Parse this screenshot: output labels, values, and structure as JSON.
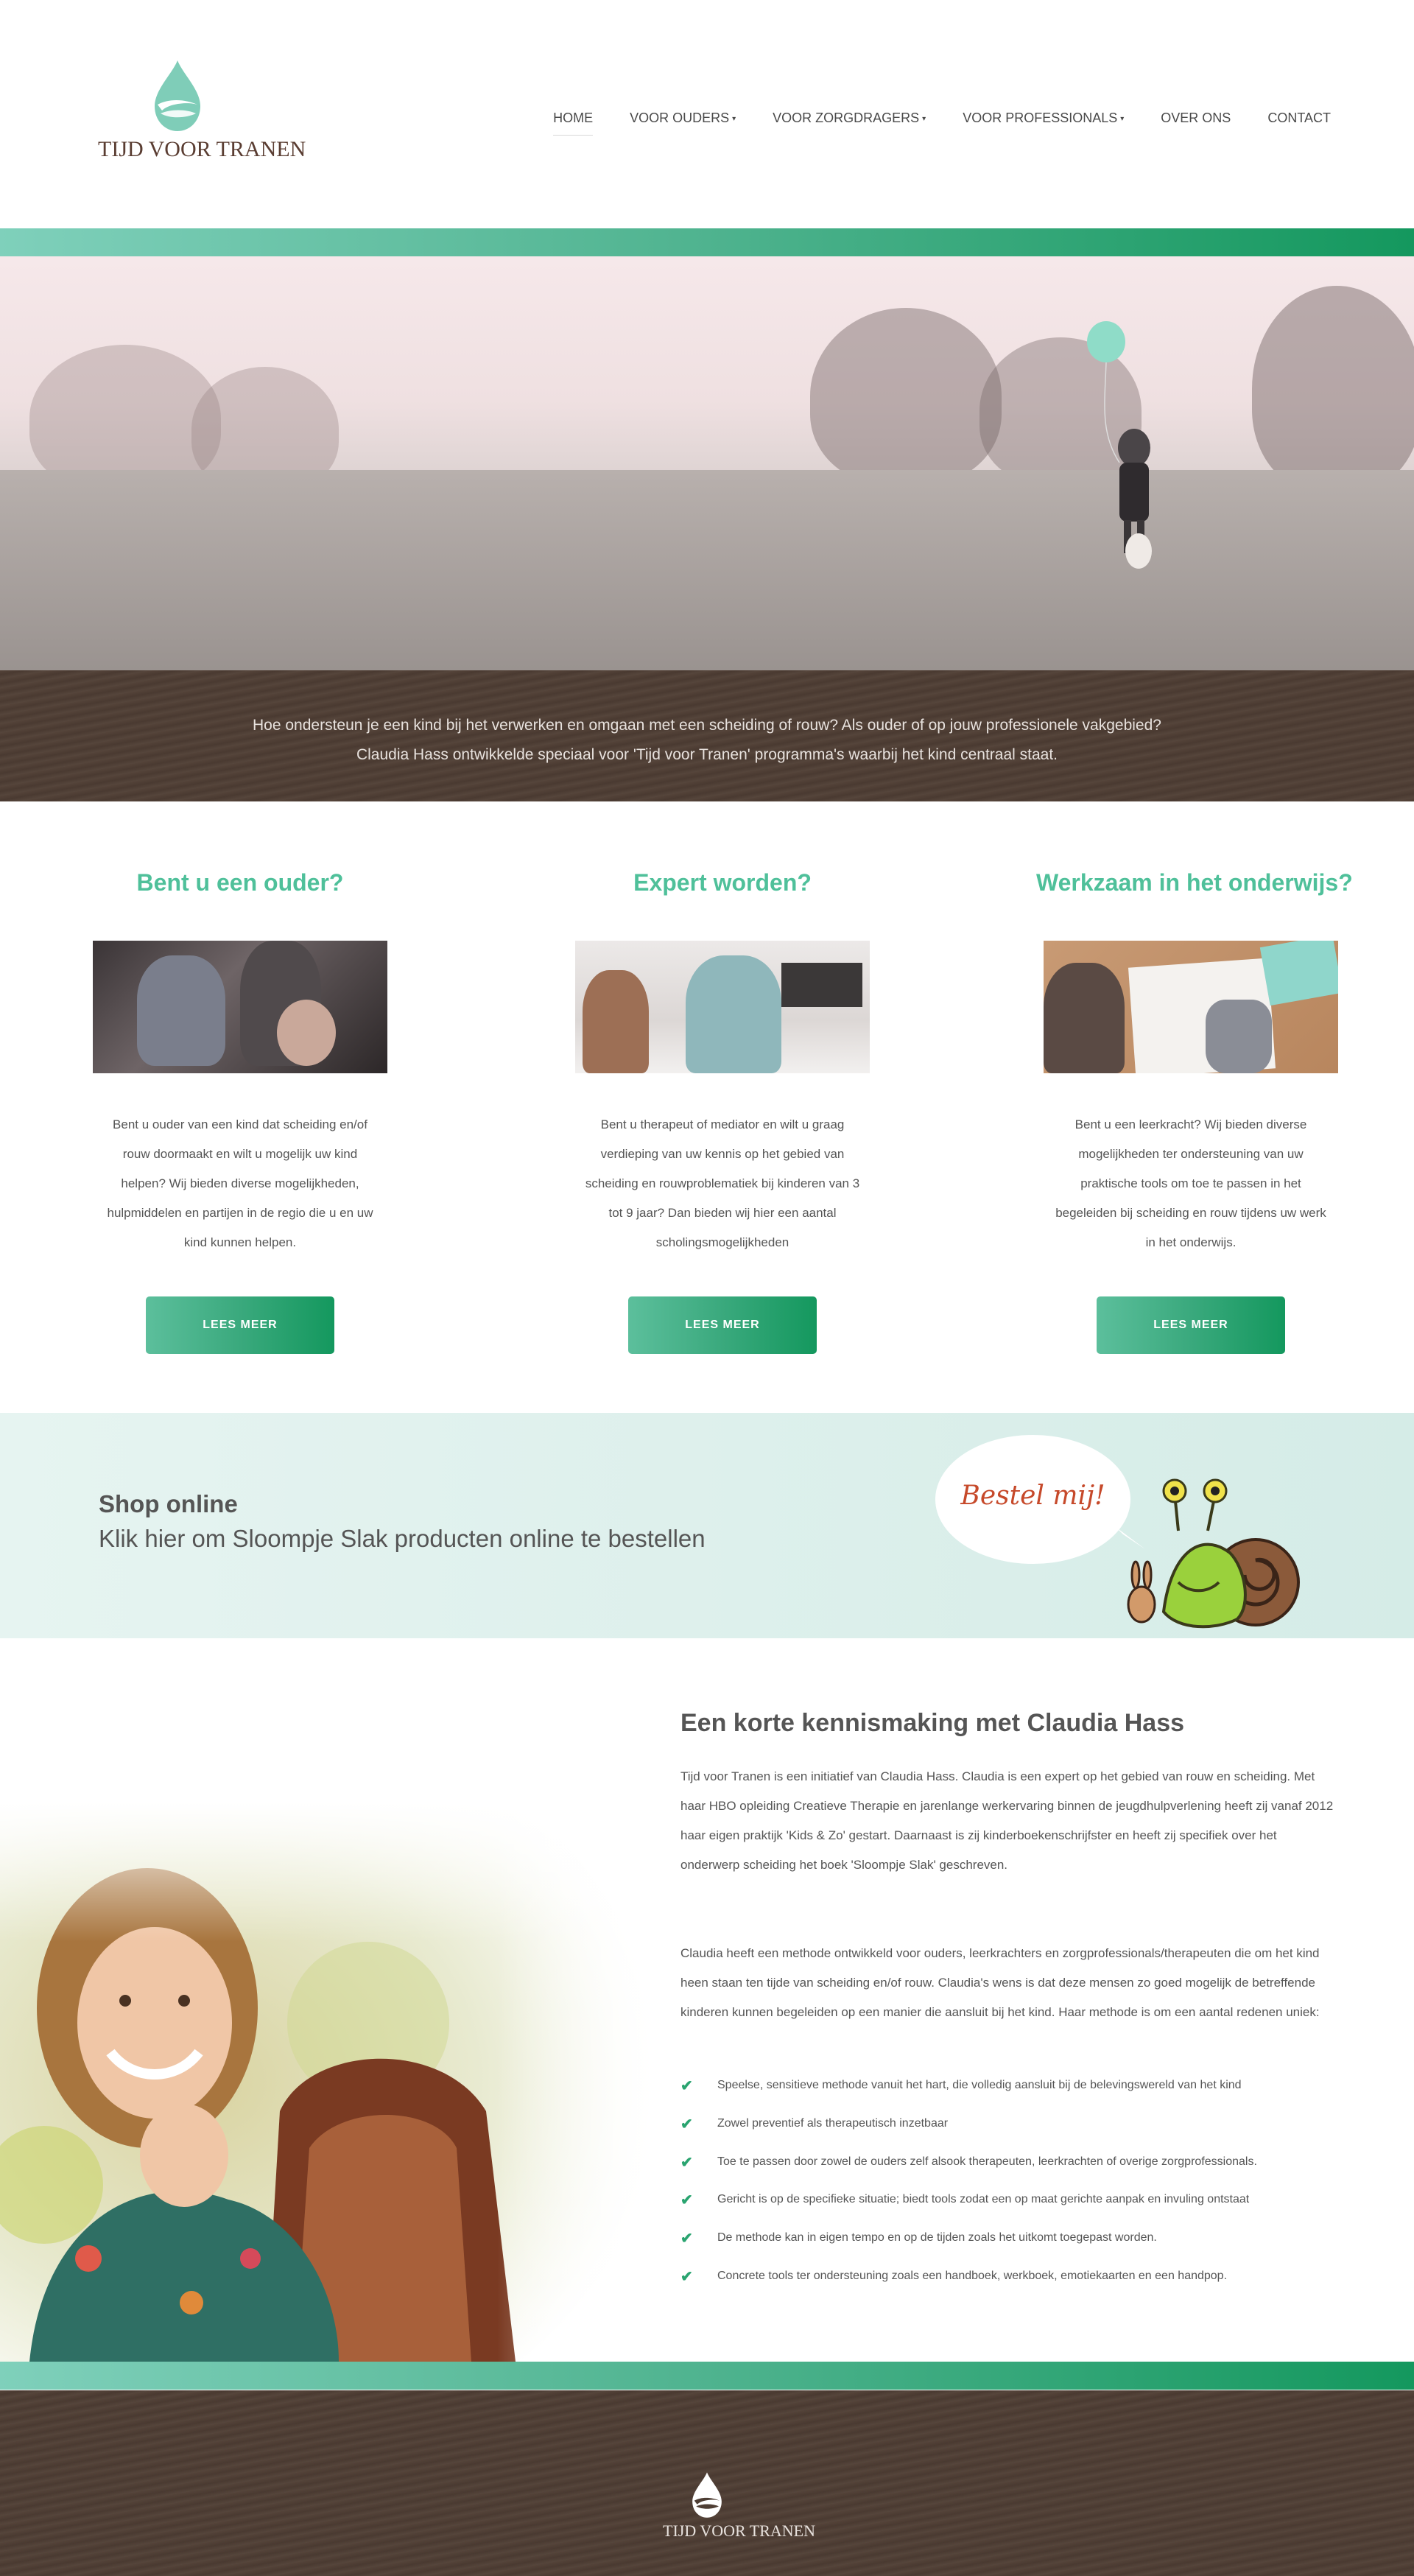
{
  "brand": {
    "name": "TIJD VOOR TRANEN",
    "accent": "#4fc09a",
    "accent_dark": "#14985e",
    "brown": "#4e3e34"
  },
  "nav": {
    "items": [
      {
        "label": "HOME",
        "caret": ""
      },
      {
        "label": "VOOR OUDERS",
        "caret": "▾"
      },
      {
        "label": "VOOR ZORGDRAGERS",
        "caret": "▾"
      },
      {
        "label": "VOOR PROFESSIONALS",
        "caret": "▾"
      },
      {
        "label": "OVER ONS",
        "caret": ""
      },
      {
        "label": "CONTACT",
        "caret": ""
      }
    ]
  },
  "intro": {
    "line1": "Hoe ondersteun je een kind bij het verwerken en omgaan met een scheiding of rouw? Als ouder of op jouw professionele vakgebied?",
    "line2": "Claudia Hass ontwikkelde speciaal voor 'Tijd voor Tranen' programma's waarbij het kind centraal staat."
  },
  "columns": [
    {
      "title": "Bent u een ouder?",
      "text": "Bent u ouder van een kind dat scheiding en/of rouw doormaakt en wilt u mogelijk uw kind helpen? Wij bieden diverse mogelijkheden, hulpmiddelen en partijen in de regio die u en uw kind kunnen helpen.",
      "button": "LEES MEER"
    },
    {
      "title": "Expert worden?",
      "text": "Bent u therapeut of mediator en wilt u graag verdieping van uw kennis op het gebied van scheiding en rouwproblematiek bij kinderen van 3 tot 9 jaar? Dan bieden wij hier een aantal scholingsmogelijkheden",
      "button": "LEES MEER"
    },
    {
      "title": "Werkzaam in het onderwijs?",
      "text": "Bent u een leerkracht? Wij bieden diverse mogelijkheden ter ondersteuning van uw praktische tools om toe te passen in het begeleiden bij scheiding en rouw tijdens uw werk in het onderwijs.",
      "button": "LEES MEER"
    }
  ],
  "shop": {
    "title": "Shop online",
    "subtitle": "Klik hier om Sloompje Slak producten online te bestellen",
    "bubble": "Bestel mij!"
  },
  "about": {
    "title": "Een korte kennismaking met Claudia Hass",
    "p1": "Tijd voor Tranen is een initiatief van Claudia Hass. Claudia is een expert op het gebied van rouw en scheiding. Met haar HBO opleiding Creatieve Therapie en jarenlange werkervaring binnen de jeugdhulpverlening heeft zij vanaf 2012 haar eigen praktijk 'Kids & Zo' gestart. Daarnaast is zij kinderboekenschrijfster en heeft zij specifiek over het onderwerp scheiding het boek 'Sloompje Slak' geschreven.",
    "p2": "Claudia heeft een methode ontwikkeld voor ouders, leerkrachters en zorgprofessionals/therapeuten die om het kind heen staan ten tijde van scheiding en/of rouw. Claudia's wens is dat deze mensen zo goed mogelijk de betreffende kinderen kunnen begeleiden op een manier die aansluit bij het kind. Haar methode is om een aantal redenen uniek:",
    "checks": [
      "Speelse, sensitieve methode vanuit het hart, die volledig aansluit bij de belevingswereld van het kind",
      "Zowel preventief als therapeutisch inzetbaar",
      "Toe te passen door zowel de ouders zelf alsook therapeuten, leerkrachten of overige zorgprofessionals.",
      "Gericht is op de specifieke situatie; biedt tools zodat een op maat gerichte aanpak en invuling ontstaat",
      "De methode kan in eigen tempo en op de tijden zoals het uitkomt toegepast worden.",
      "Concrete tools ter ondersteuning zoals een handboek, werkboek, emotiekaarten en een handpop."
    ]
  },
  "footer": {
    "logo_text": "TIJD VOOR TRANEN"
  }
}
